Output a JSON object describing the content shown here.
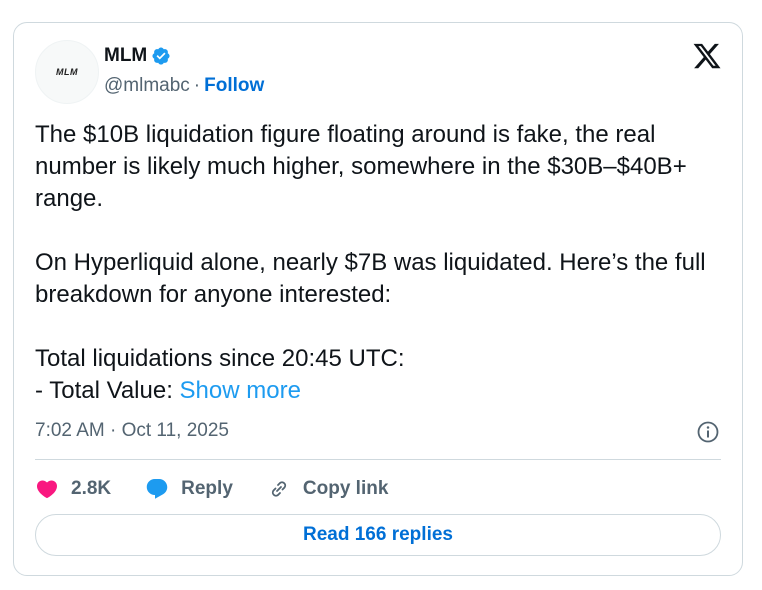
{
  "author": {
    "avatar_text": "MLM",
    "name": "MLM",
    "handle": "@mlmabc",
    "separator": "·",
    "follow_label": "Follow"
  },
  "icons": {
    "verified": "verified-badge-icon",
    "platform": "x-logo-icon",
    "info": "info-icon",
    "like": "heart-icon",
    "reply": "speech-bubble-icon",
    "copy": "link-icon"
  },
  "colors": {
    "accent": "#1d9bf0",
    "link": "#006fd6",
    "like": "#f91880",
    "muted": "#536471"
  },
  "tweet": {
    "paragraph1": "The $10B liquidation figure floating around is fake, the real number is likely much higher, somewhere in the $30B–$40B+ range.",
    "paragraph2": "On Hyperliquid alone, nearly $7B was liquidated. Here’s the full breakdown for anyone interested:",
    "paragraph3_line1": "Total liquidations since 20:45 UTC:",
    "paragraph3_line2": "- Total Value: ",
    "show_more": "Show more"
  },
  "meta": {
    "timestamp": "7:02 AM · Oct 11, 2025"
  },
  "actions": {
    "likes": "2.8K",
    "reply_label": "Reply",
    "copy_link_label": "Copy link"
  },
  "footer": {
    "read_replies_label": "Read 166 replies"
  }
}
